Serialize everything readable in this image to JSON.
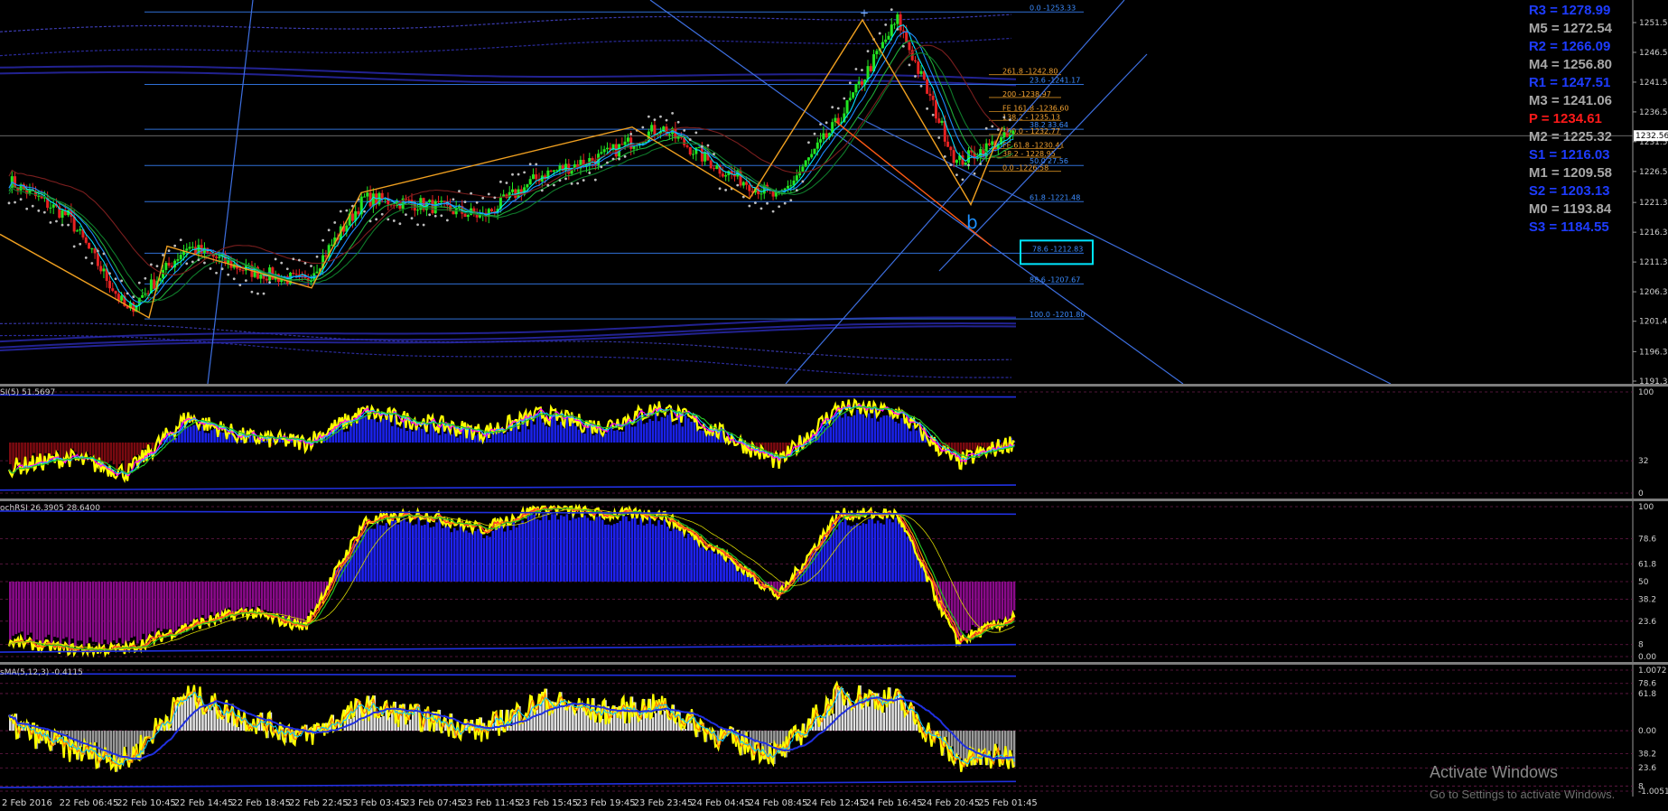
{
  "colors": {
    "background": "#000000",
    "fib_line": "#2f6fd6",
    "fib_text": "#3c8cff",
    "ext_text": "#f0a030",
    "pivot_blue": "#1e3cff",
    "pivot_gray": "#a8a8a8",
    "pivot_red": "#ff1a1a",
    "candle_up": "#22e622",
    "candle_down": "#e62222",
    "yellow": "#ffff00",
    "highlight_box": "#00e5ff"
  },
  "pivots": [
    {
      "label": "R3 = 1278.99",
      "color": "#1e3cff"
    },
    {
      "label": "M5 = 1272.54",
      "color": "#a8a8a8"
    },
    {
      "label": "R2 = 1266.09",
      "color": "#1e3cff"
    },
    {
      "label": "M4 = 1256.80",
      "color": "#a8a8a8"
    },
    {
      "label": "R1 = 1247.51",
      "color": "#1e3cff"
    },
    {
      "label": "M3 = 1241.06",
      "color": "#a8a8a8"
    },
    {
      "label": "P  = 1234.61",
      "color": "#ff1a1a"
    },
    {
      "label": "M2 = 1225.32",
      "color": "#a8a8a8"
    },
    {
      "label": "S1 = 1216.03",
      "color": "#1e3cff"
    },
    {
      "label": "M1 = 1209.58",
      "color": "#a8a8a8"
    },
    {
      "label": "S2 = 1203.13",
      "color": "#1e3cff"
    },
    {
      "label": "M0 = 1193.84",
      "color": "#a8a8a8"
    },
    {
      "label": "S3 = 1184.55",
      "color": "#1e3cff"
    }
  ],
  "current_price": "1232.56",
  "fib_levels": [
    {
      "text": "0.0 -1253.33",
      "price": 1253.33
    },
    {
      "text": "23.6 -1241.17",
      "price": 1241.17
    },
    {
      "text": "38.2 -",
      "price": 1233.64,
      "right_text": "33.64"
    },
    {
      "text": "50.0 -",
      "price": 1227.56,
      "right_text": "27.56"
    },
    {
      "text": "61.8 -1221.48",
      "price": 1221.48
    },
    {
      "text": "78.6 -1212.83",
      "price": 1212.83
    },
    {
      "text": "88.6 -1207.67",
      "price": 1207.67
    },
    {
      "text": "100.0 -1201.80",
      "price": 1201.8
    }
  ],
  "ext_levels": [
    {
      "text": "261.8 -1242.80",
      "price": 1242.8
    },
    {
      "text": "200 -1238.97",
      "price": 1238.97
    },
    {
      "text": "FE 161.8 -1236.60",
      "price": 1236.6
    },
    {
      "text": "138.2 - 1235.13",
      "price": 1235.13
    },
    {
      "text": "100.0 - 1232.77",
      "price": 1232.77
    },
    {
      "text": "FE 61.8 -1230.41",
      "price": 1230.41
    },
    {
      "text": "38.2 - 1228.95",
      "price": 1228.95
    },
    {
      "text": "0.0 -1226.58",
      "price": 1226.58
    }
  ],
  "wave_label": "b",
  "indicators": {
    "rsi_label": "SI(5) 51.5697",
    "stoch_label": "ochRSI 26.3905 28.6400",
    "ma_label": "sMA(5,12,3) -0.4115"
  },
  "axes": {
    "main_ticks": [
      "1251.55",
      "1246.55",
      "1241.55",
      "1236.55",
      "1231.55",
      "1226.55",
      "1221.35",
      "1216.35",
      "1211.35",
      "1206.35",
      "1201.40",
      "1196.30",
      "1191.35"
    ],
    "rsi_ticks": [
      "100",
      "32",
      "0"
    ],
    "stoch_ticks": [
      "100",
      "78.6",
      "61.8",
      "50",
      "38.2",
      "23.6",
      "8",
      "0.00"
    ],
    "ma_ticks": [
      "1.0072",
      "78.6",
      "61.8",
      "0.00",
      "38.2",
      "23.6",
      "8",
      "-1.0051"
    ]
  },
  "x_ticks": [
    "2 Feb 2016",
    "22 Feb 06:45",
    "22 Feb 10:45",
    "22 Feb 14:45",
    "22 Feb 18:45",
    "22 Feb 22:45",
    "23 Feb 03:45",
    "23 Feb 07:45",
    "23 Feb 11:45",
    "23 Feb 15:45",
    "23 Feb 19:45",
    "23 Feb 23:45",
    "24 Feb 04:45",
    "24 Feb 08:45",
    "24 Feb 12:45",
    "24 Feb 16:45",
    "24 Feb 20:45",
    "25 Feb 01:45"
  ],
  "watermark": {
    "line1": "Activate Windows",
    "line2": "Go to Settings to activate Windows."
  },
  "chart_data": [
    {
      "type": "line",
      "title": "",
      "ylim": [
        1191.35,
        1251.55
      ],
      "x": [
        "2 Feb 2016",
        "22 Feb 06:45",
        "22 Feb 10:45",
        "22 Feb 14:45",
        "22 Feb 18:45",
        "22 Feb 22:45",
        "23 Feb 03:45",
        "23 Feb 07:45",
        "23 Feb 11:45",
        "23 Feb 15:45",
        "23 Feb 19:45",
        "23 Feb 23:45",
        "24 Feb 04:45",
        "24 Feb 08:45",
        "24 Feb 12:45",
        "24 Feb 16:45",
        "24 Feb 20:45",
        "25 Feb 01:45"
      ],
      "series": [
        {
          "name": "price",
          "values": [
            1225,
            1219,
            1203,
            1214,
            1210,
            1208,
            1222,
            1221,
            1219,
            1226,
            1229,
            1234,
            1227,
            1222,
            1235,
            1252,
            1228,
            1233
          ]
        }
      ]
    },
    {
      "type": "line",
      "ylim": [
        0,
        100
      ],
      "series": [
        {
          "name": "RSI",
          "values": [
            25,
            35,
            20,
            75,
            55,
            50,
            80,
            70,
            60,
            78,
            65,
            85,
            60,
            30,
            85,
            80,
            30,
            51.57
          ]
        }
      ]
    },
    {
      "type": "line",
      "ylim": [
        0,
        100
      ],
      "series": [
        {
          "name": "StochRSI",
          "values": [
            10,
            5,
            5,
            20,
            30,
            20,
            90,
            95,
            85,
            100,
            95,
            95,
            70,
            40,
            95,
            95,
            10,
            26.39
          ]
        }
      ]
    },
    {
      "type": "line",
      "ylim": [
        -1.0051,
        1.0072
      ],
      "series": [
        {
          "name": "sMA",
          "values": [
            0.1,
            -0.3,
            -0.5,
            0.6,
            0.2,
            -0.1,
            0.4,
            0.2,
            0.0,
            0.5,
            0.3,
            0.4,
            -0.1,
            -0.4,
            0.6,
            0.5,
            -0.5,
            -0.4115
          ]
        }
      ]
    }
  ]
}
